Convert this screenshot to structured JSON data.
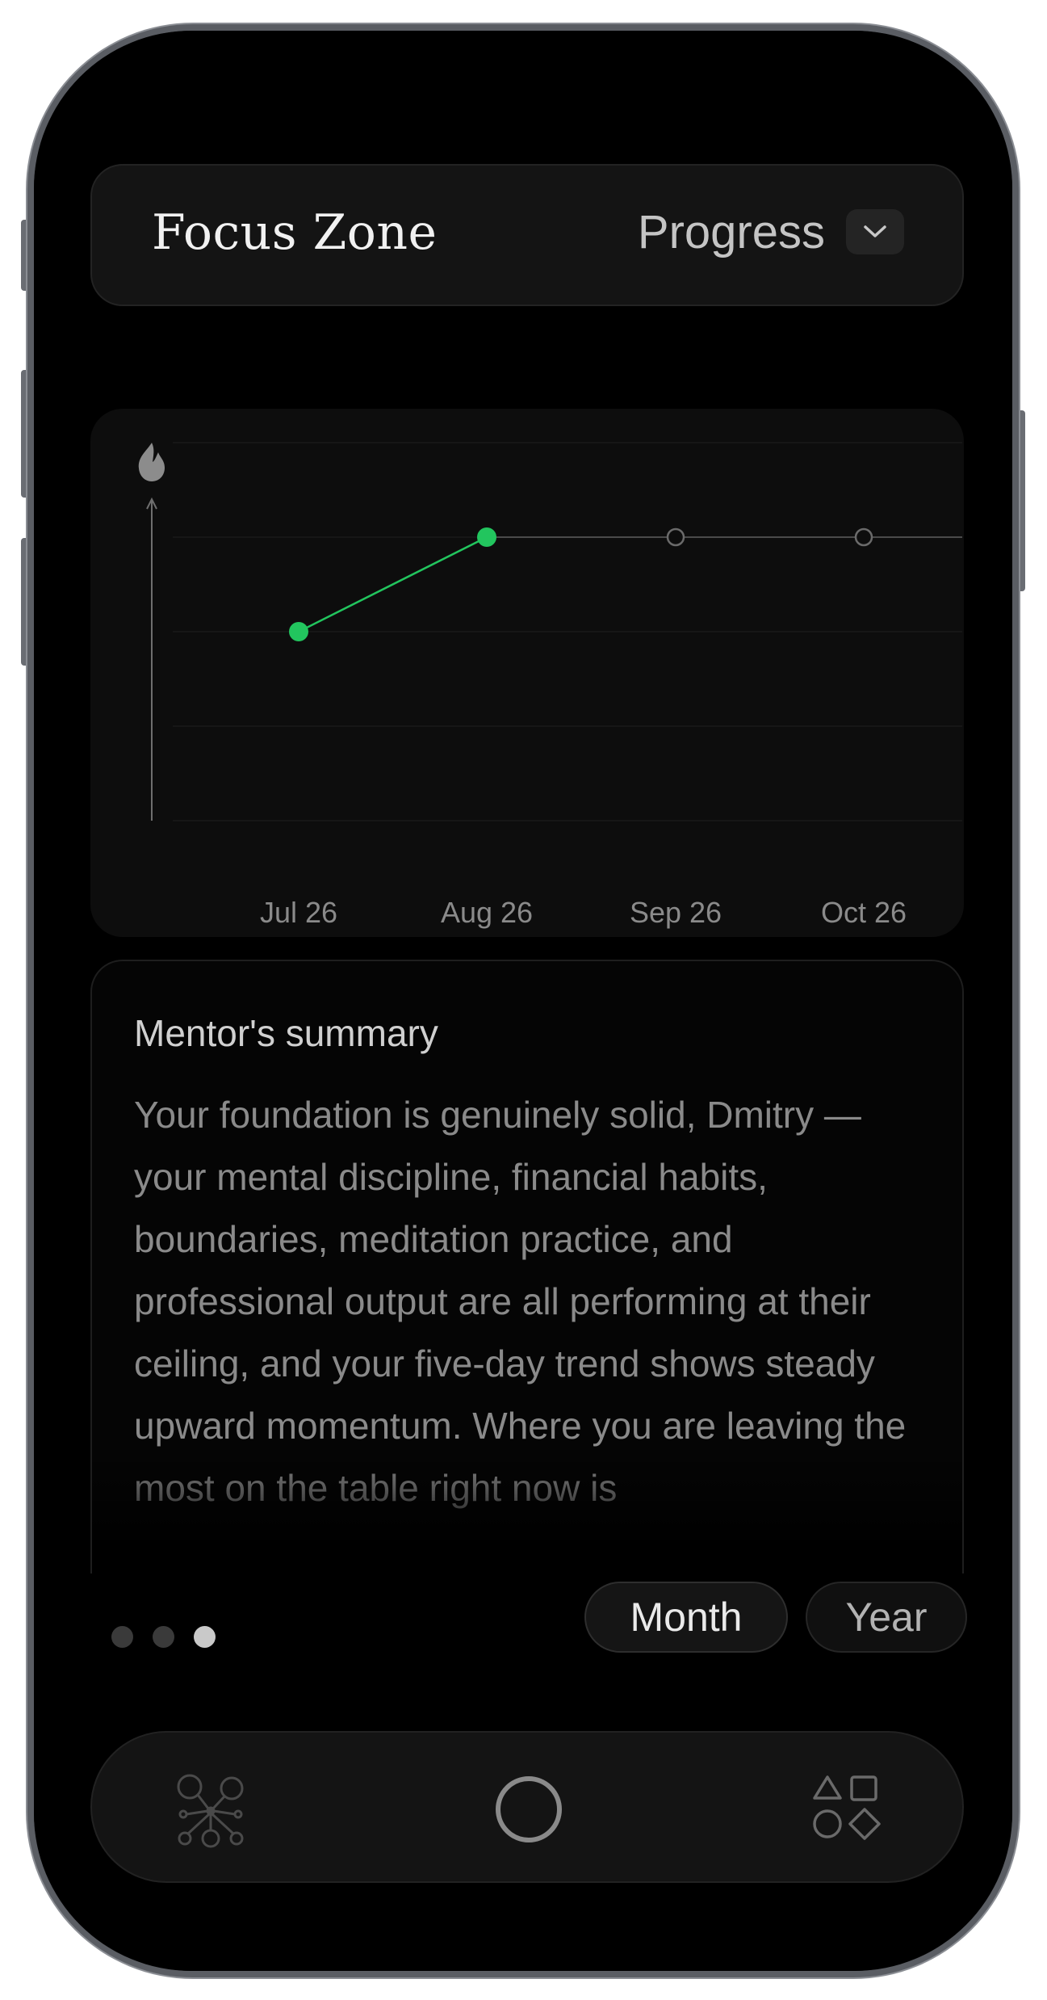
{
  "header": {
    "app_title": "Focus Zone",
    "view_selector": {
      "label": "Progress",
      "icon": "chevron-down-icon"
    }
  },
  "chart_data": {
    "type": "line",
    "x": [
      "Jul 26",
      "Aug 26",
      "Sep 26",
      "Oct 26"
    ],
    "series": [
      {
        "values": [
          2,
          3,
          3,
          3
        ],
        "filled": [
          true,
          true,
          false,
          false
        ],
        "color": "#22c55e"
      }
    ],
    "ylim": [
      0,
      4
    ],
    "y_axis_icon": "flame-icon",
    "grid": true
  },
  "summary": {
    "title": "Mentor's summary",
    "body": "Your foundation is genuinely solid, Dmitry — your mental discipline, financial habits, boundaries, meditation practice, and professional output are all performing at their ceiling, and your five-day trend shows steady upward momentum. Where you are leaving the most on the table right now is"
  },
  "pager": {
    "count": 3,
    "active_index": 2
  },
  "period_toggle": {
    "options": [
      "Month",
      "Year"
    ],
    "selected": "Month"
  },
  "bottom_nav": {
    "items": [
      {
        "icon": "network-icon"
      },
      {
        "icon": "circle-home-icon"
      },
      {
        "icon": "shapes-icon"
      }
    ]
  },
  "colors": {
    "accent": "#22c55e",
    "background": "#000000"
  }
}
